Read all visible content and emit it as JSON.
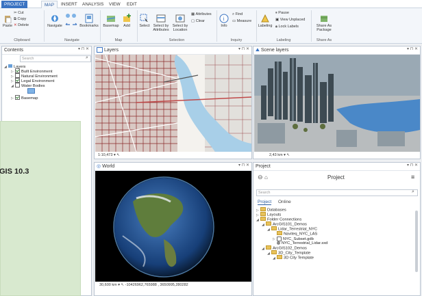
{
  "ribbon": {
    "tabs": [
      "PROJECT",
      "MAP",
      "INSERT",
      "ANALYSIS",
      "VIEW",
      "EDIT"
    ],
    "clipboard": {
      "cut": "Cut",
      "copy": "Copy",
      "delete": "Delete",
      "paste": "Paste",
      "label": "Clipboard"
    },
    "navigate": {
      "navigate": "Navigate",
      "bookmarks": "Bookmarks",
      "label": "Navigate"
    },
    "map": {
      "basemap": "Basemap",
      "add": "Add",
      "label": "Map"
    },
    "selection": {
      "select": "Select",
      "by_attr_1": "Select by",
      "by_attr_2": "Attributes",
      "by_loc_1": "Select by",
      "by_loc_2": "Location",
      "attributes": "Attributes",
      "clear": "Clear",
      "label": "Selection"
    },
    "inquiry": {
      "info": "Info",
      "find": "Find",
      "measure": "Measure",
      "label": "Inquiry"
    },
    "labeling": {
      "labeling": "Labeling",
      "pause": "Pause",
      "view_unplaced": "View Unplaced",
      "lock_labels": "Lock Labels",
      "label": "Labeling"
    },
    "share": {
      "share_as_1": "Share As",
      "share_as_2": "Package",
      "label": "Share As"
    }
  },
  "contents": {
    "title": "Contents",
    "search_placeholder": "Search",
    "layers": [
      {
        "label": "Layers",
        "checked": true
      },
      {
        "label": "Built Environment",
        "checked": true
      },
      {
        "label": "Natural Environment",
        "checked": false
      },
      {
        "label": "Legal Environment",
        "checked": true
      },
      {
        "label": "Water Bodies",
        "checked": false
      },
      {
        "label": "Basemap",
        "checked": true
      }
    ]
  },
  "overlay": {
    "text": "GIS 10.3"
  },
  "views": {
    "layers": {
      "title": "Layers",
      "scale": "1:10,473"
    },
    "scene": {
      "title": "Scene layers",
      "scale": "2,43 km"
    },
    "world": {
      "title": "World",
      "scale": "30,600 km",
      "coords": "-10426962,765988 , 3650995,280282"
    }
  },
  "project": {
    "title": "Project",
    "pane_label": "Project",
    "search_placeholder": "Search",
    "tabs": [
      "Project",
      "Online"
    ],
    "items": [
      "Databases",
      "Layouts",
      "Folder Connections",
      "ArcGIS101_Demos",
      "Lidar_Terrestrial_NYC",
      "Naviteq_NYC_LAS",
      "NYC_Subset.gdb",
      "NYC_Terrestrial_Lidar.sxd",
      "ArcGIS102_Demos",
      "3D_City_Template",
      "3D City Template"
    ]
  },
  "colors": {
    "accent": "#3a73c2",
    "overlay": "#d8e9cf"
  }
}
